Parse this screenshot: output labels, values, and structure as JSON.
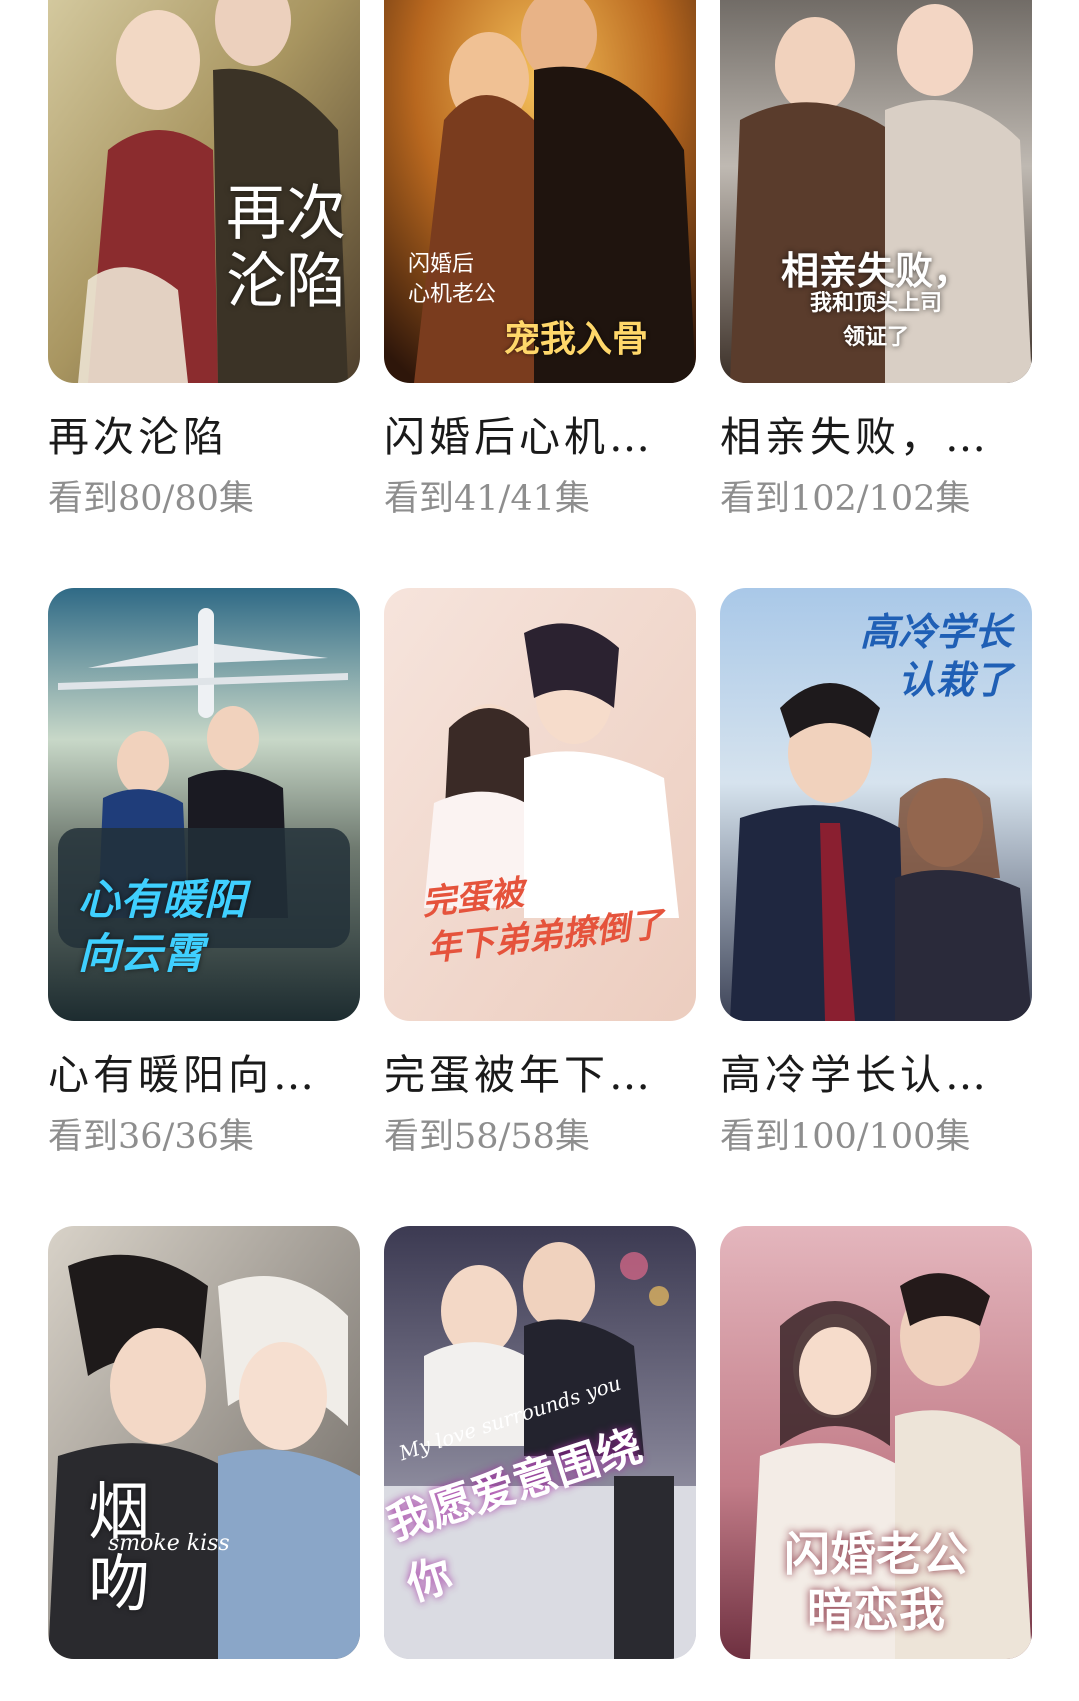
{
  "dramas": [
    {
      "title": "再次沦陷",
      "progress": "看到80/80集",
      "poster_title": "再次\n沦陷",
      "poster_subtitle": "",
      "colors": {
        "bg1": "#c8b98a",
        "bg2": "#5b4a36",
        "accent": "#ffffff"
      }
    },
    {
      "title": "闪婚后心机…",
      "progress": "看到41/41集",
      "poster_title": "宠我入骨",
      "poster_subtitle": "闪婚后\n心机老公",
      "colors": {
        "bg1": "#e8a53a",
        "bg2": "#3a1d0e",
        "accent": "#ffd76a"
      }
    },
    {
      "title": "相亲失败，…",
      "progress": "看到102/102集",
      "poster_title": "相亲失败，",
      "poster_subtitle": "我和顶头上司\n领证了",
      "colors": {
        "bg1": "#b8b2ac",
        "bg2": "#4a3a30",
        "accent": "#ffffff"
      }
    },
    {
      "title": "心有暖阳向…",
      "progress": "看到36/36集",
      "poster_title": "心有暖阳\n向云霄",
      "poster_subtitle": "",
      "colors": {
        "bg1": "#9fc3d6",
        "bg2": "#1c3540",
        "accent": "#3fd0ff"
      }
    },
    {
      "title": "完蛋被年下…",
      "progress": "看到58/58集",
      "poster_title": "完蛋被\n年下弟弟撩倒了",
      "poster_subtitle": "",
      "colors": {
        "bg1": "#f4e2da",
        "bg2": "#e8c9bd",
        "accent": "#e5533c"
      }
    },
    {
      "title": "高冷学长认…",
      "progress": "看到100/100集",
      "poster_title": "高冷学长\n认栽了",
      "poster_subtitle": "",
      "colors": {
        "bg1": "#a9c8e8",
        "bg2": "#2a2f45",
        "accent": "#1f5fb5"
      }
    },
    {
      "title": "",
      "progress": "",
      "poster_title": "烟\n吻",
      "poster_subtitle": "smoke kiss",
      "colors": {
        "bg1": "#cfc9c0",
        "bg2": "#3a3836",
        "accent": "#ffffff"
      }
    },
    {
      "title": "",
      "progress": "",
      "poster_title": "我愿爱意围绕你",
      "poster_subtitle": "My love surrounds you",
      "colors": {
        "bg1": "#4a4a60",
        "bg2": "#a8a8b8",
        "accent": "#ffffff"
      }
    },
    {
      "title": "",
      "progress": "",
      "poster_title": "闪婚老公\n暗恋我",
      "poster_subtitle": "",
      "colors": {
        "bg1": "#d89aa6",
        "bg2": "#7a3a48",
        "accent": "#ffffff"
      }
    }
  ]
}
